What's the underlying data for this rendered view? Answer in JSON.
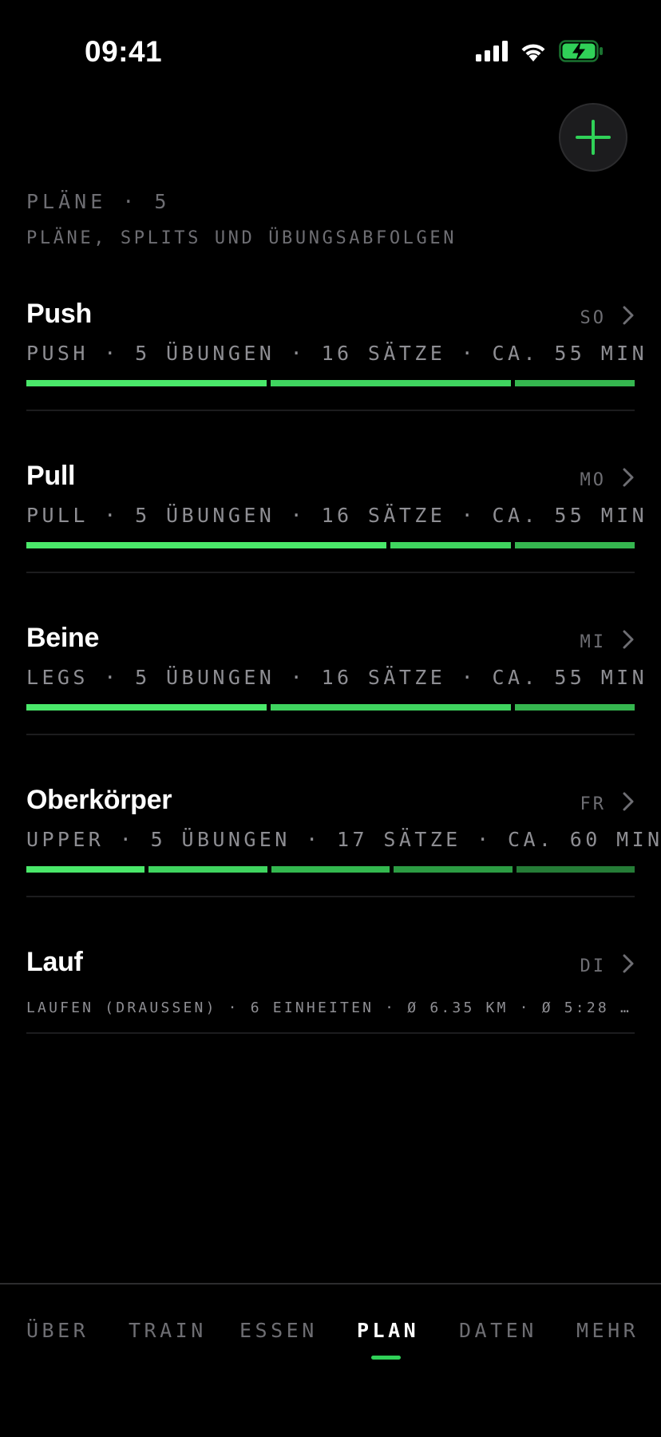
{
  "status_bar": {
    "time": "09:41",
    "icons": [
      "cellular-icon",
      "wifi-icon",
      "battery-charging-icon"
    ]
  },
  "header": {
    "count_label": "PLÄNE · 5",
    "subtitle": "PLÄNE, SPLITS UND ÜBUNGSABFOLGEN",
    "add_icon": "plus-icon"
  },
  "plans": [
    {
      "name": "Push",
      "day": "SO",
      "meta": "PUSH · 5 ÜBUNGEN · 16 SÄTZE · CA. 55 MIN",
      "segments": [
        {
          "weight": 2,
          "color": "#4ae86a"
        },
        {
          "weight": 2,
          "color": "#3fd45f"
        },
        {
          "weight": 1,
          "color": "#35b64f"
        }
      ]
    },
    {
      "name": "Pull",
      "day": "MO",
      "meta": "PULL · 5 ÜBUNGEN · 16 SÄTZE · CA. 55 MIN",
      "segments": [
        {
          "weight": 3,
          "color": "#4ae86a"
        },
        {
          "weight": 1,
          "color": "#3fd45f"
        },
        {
          "weight": 1,
          "color": "#35b64f"
        }
      ]
    },
    {
      "name": "Beine",
      "day": "MI",
      "meta": "LEGS · 5 ÜBUNGEN · 16 SÄTZE · CA. 55 MIN",
      "segments": [
        {
          "weight": 2,
          "color": "#4ae86a"
        },
        {
          "weight": 2,
          "color": "#3fd45f"
        },
        {
          "weight": 1,
          "color": "#35b64f"
        }
      ]
    },
    {
      "name": "Oberkörper",
      "day": "FR",
      "meta": "UPPER · 5 ÜBUNGEN · 17 SÄTZE · CA. 60 MIN",
      "segments": [
        {
          "weight": 1,
          "color": "#4ae86a"
        },
        {
          "weight": 1,
          "color": "#3fd45f"
        },
        {
          "weight": 1,
          "color": "#33b84f"
        },
        {
          "weight": 1,
          "color": "#2c9c43"
        },
        {
          "weight": 1,
          "color": "#257c37"
        }
      ]
    },
    {
      "name": "Lauf",
      "day": "DI",
      "meta": "LAUFEN (DRAUSSEN) · 6 EINHEITEN · Ø 6.35 KM · Ø 5:28 /…",
      "segments": []
    }
  ],
  "tabs": [
    {
      "label": "ÜBER",
      "active": false
    },
    {
      "label": "TRAIN",
      "active": false
    },
    {
      "label": "ESSEN",
      "active": false
    },
    {
      "label": "PLAN",
      "active": true
    },
    {
      "label": "DATEN",
      "active": false
    },
    {
      "label": "MEHR",
      "active": false
    }
  ],
  "colors": {
    "accent": "#30d158",
    "background": "#000000",
    "muted_text": "#6e6e73"
  }
}
